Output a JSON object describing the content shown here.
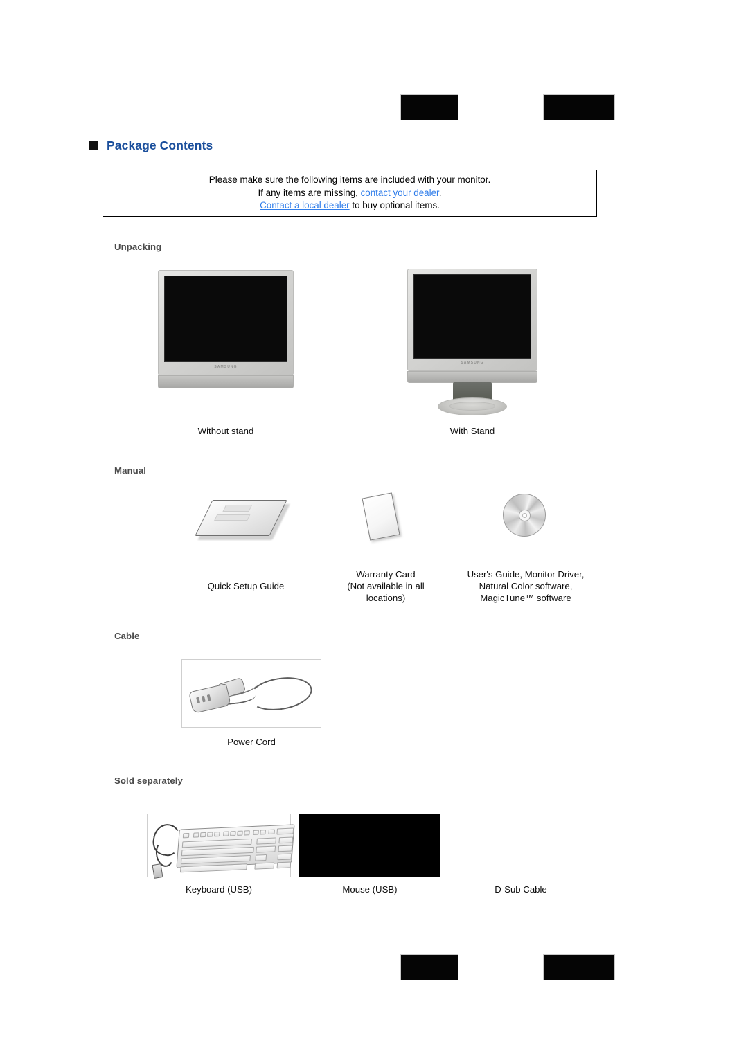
{
  "page": {
    "title": "Package Contents",
    "title_bullet_color": "#111111",
    "title_color": "#1b4f9c"
  },
  "nav": {
    "top": {
      "left_button_label": "",
      "right_button_label": ""
    },
    "bottom": {
      "left_button_label": "",
      "right_button_label": ""
    }
  },
  "notice": {
    "line1": "Please make sure the following items are included with your monitor.",
    "line2_prefix": "If any items are missing, ",
    "line2_link": "contact your dealer",
    "line2_suffix": ".",
    "line3_link": "Contact a local dealer",
    "line3_suffix": " to buy optional items.",
    "link_color": "#2f7dea"
  },
  "groups": {
    "unpacking": "Unpacking",
    "manual": "Manual",
    "cable": "Cable",
    "sold_separately": "Sold separately"
  },
  "unpacking": {
    "items": [
      {
        "caption": "Without stand",
        "image": "monitor-without-stand",
        "brand": "SAMSUNG"
      },
      {
        "caption": "With Stand",
        "image": "monitor-with-stand",
        "brand": "SAMSUNG"
      }
    ]
  },
  "manual": {
    "items": [
      {
        "caption": "Quick Setup Guide",
        "image": "booklet"
      },
      {
        "caption": "Warranty Card\n(Not available in all\nlocations)",
        "image": "warranty-card"
      },
      {
        "caption": "User's Guide, Monitor Driver,\nNatural Color software,\nMagicTune™ software",
        "image": "cd-disc"
      }
    ]
  },
  "cable": {
    "items": [
      {
        "caption": "Power Cord",
        "image": "power-cord"
      }
    ]
  },
  "sold_separately": {
    "items": [
      {
        "caption": "Keyboard (USB)",
        "image": "usb-keyboard"
      },
      {
        "caption": "Mouse (USB)",
        "image": "usb-mouse"
      },
      {
        "caption": "D-Sub Cable",
        "image": "d-sub-cable"
      }
    ]
  }
}
